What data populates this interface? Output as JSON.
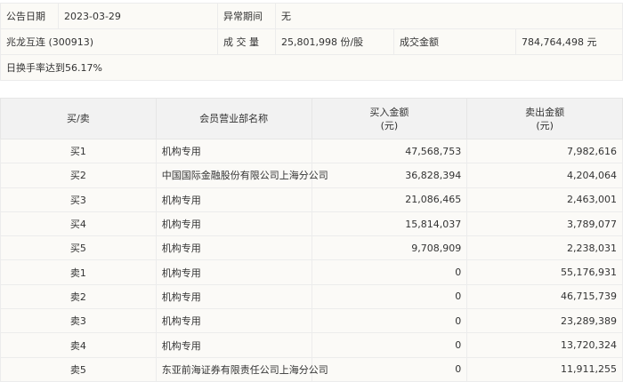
{
  "info": {
    "date_label": "公告日期",
    "date": "2023-03-29",
    "period_label": "异常期间",
    "period": "无",
    "stock": "兆龙互连 (300913)",
    "volume_label": "成 交 量",
    "volume": "25,801,998 份/股",
    "amount_label": "成交金额",
    "amount": "784,764,498 元",
    "reason": "日换手率达到56.17%"
  },
  "table": {
    "headers": [
      "买/卖",
      "会员营业部名称",
      "买入金额\n(元)",
      "卖出金额\n(元)"
    ],
    "h": {
      "side": "买/卖",
      "name": "会员营业部名称",
      "buy1": "买入金额",
      "buy2": "(元)",
      "sell1": "卖出金额",
      "sell2": "(元)"
    },
    "rows": [
      [
        "买1",
        "机构专用",
        "47,568,753",
        "7,982,616"
      ],
      [
        "买2",
        "中国国际金融股份有限公司上海分公司",
        "36,828,394",
        "4,204,064"
      ],
      [
        "买3",
        "机构专用",
        "21,086,465",
        "2,463,001"
      ],
      [
        "买4",
        "机构专用",
        "15,814,037",
        "3,789,077"
      ],
      [
        "买5",
        "机构专用",
        "9,708,909",
        "2,238,031"
      ],
      [
        "卖1",
        "机构专用",
        "0",
        "55,176,931"
      ],
      [
        "卖2",
        "机构专用",
        "0",
        "46,715,739"
      ],
      [
        "卖3",
        "机构专用",
        "0",
        "23,289,389"
      ],
      [
        "卖4",
        "机构专用",
        "0",
        "13,720,324"
      ],
      [
        "卖5",
        "东亚前海证券有限责任公司上海分公司",
        "0",
        "11,911,255"
      ]
    ]
  }
}
